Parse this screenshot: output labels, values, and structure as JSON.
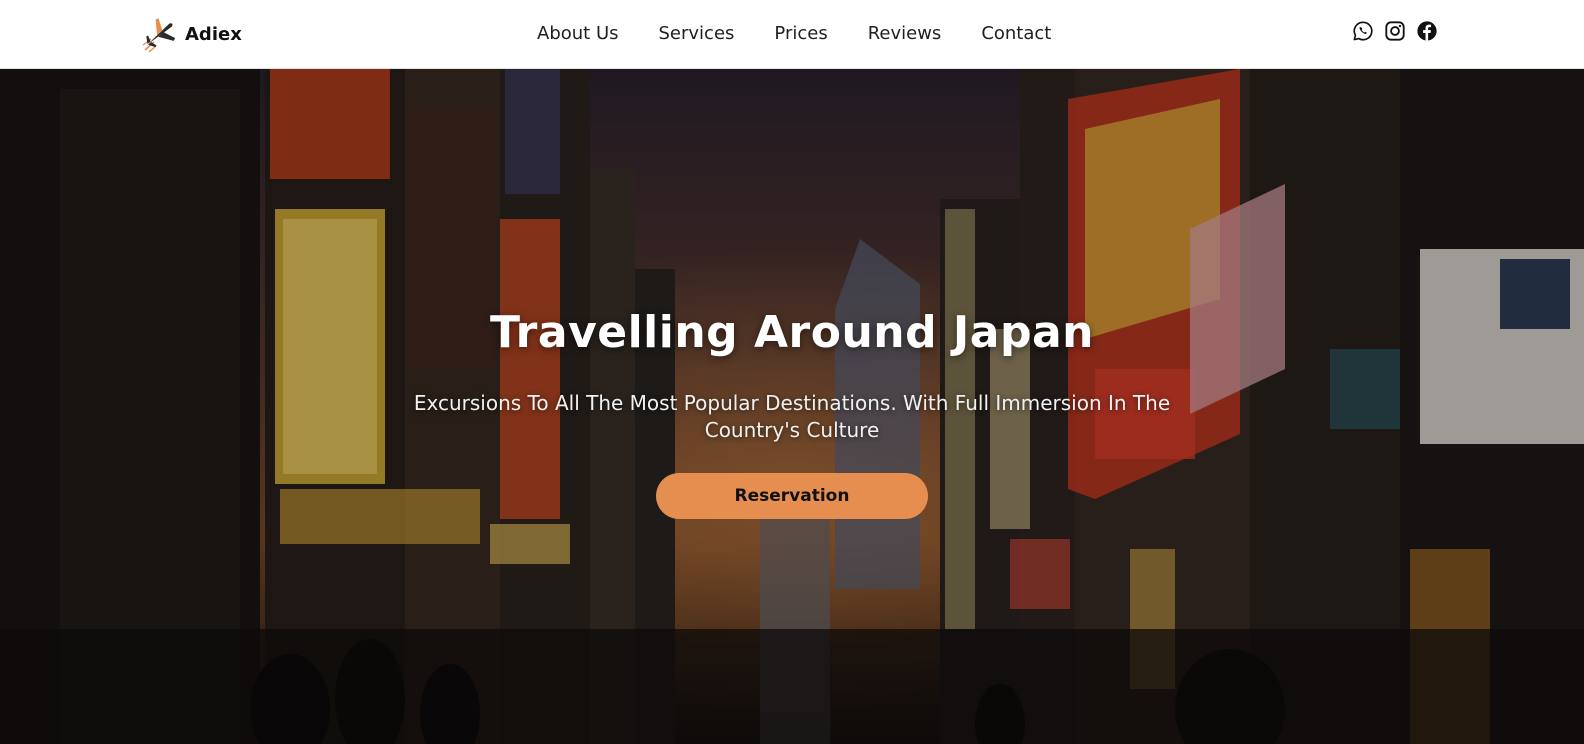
{
  "brand": {
    "name": "Adiex",
    "logo_icon": "airplane-icon",
    "logo_accent": "#e68e4f"
  },
  "nav": {
    "items": [
      {
        "label": "About Us"
      },
      {
        "label": "Services"
      },
      {
        "label": "Prices"
      },
      {
        "label": "Reviews"
      },
      {
        "label": "Contact"
      }
    ]
  },
  "socials": {
    "icons": [
      "whatsapp-icon",
      "instagram-icon",
      "facebook-icon"
    ]
  },
  "hero": {
    "title": "Travelling Around Japan",
    "subtitle": "Excursions To All The Most Popular Destinations. With Full Immersion In The Country's Culture",
    "button_label": "Reservation",
    "button_color": "#e68e4f",
    "background": "night-street-japan-image"
  }
}
